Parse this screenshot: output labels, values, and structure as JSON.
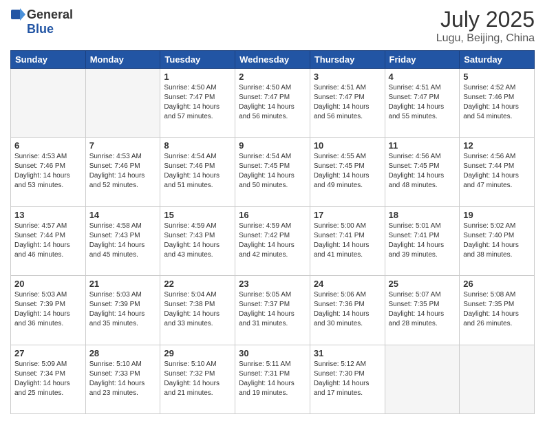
{
  "logo": {
    "general": "General",
    "blue": "Blue"
  },
  "title": {
    "month_year": "July 2025",
    "location": "Lugu, Beijing, China"
  },
  "weekdays": [
    "Sunday",
    "Monday",
    "Tuesday",
    "Wednesday",
    "Thursday",
    "Friday",
    "Saturday"
  ],
  "weeks": [
    [
      {
        "day": "",
        "empty": true
      },
      {
        "day": "",
        "empty": true
      },
      {
        "day": "1",
        "sunrise": "4:50 AM",
        "sunset": "7:47 PM",
        "daylight": "14 hours and 57 minutes."
      },
      {
        "day": "2",
        "sunrise": "4:50 AM",
        "sunset": "7:47 PM",
        "daylight": "14 hours and 56 minutes."
      },
      {
        "day": "3",
        "sunrise": "4:51 AM",
        "sunset": "7:47 PM",
        "daylight": "14 hours and 56 minutes."
      },
      {
        "day": "4",
        "sunrise": "4:51 AM",
        "sunset": "7:47 PM",
        "daylight": "14 hours and 55 minutes."
      },
      {
        "day": "5",
        "sunrise": "4:52 AM",
        "sunset": "7:46 PM",
        "daylight": "14 hours and 54 minutes."
      }
    ],
    [
      {
        "day": "6",
        "sunrise": "4:53 AM",
        "sunset": "7:46 PM",
        "daylight": "14 hours and 53 minutes."
      },
      {
        "day": "7",
        "sunrise": "4:53 AM",
        "sunset": "7:46 PM",
        "daylight": "14 hours and 52 minutes."
      },
      {
        "day": "8",
        "sunrise": "4:54 AM",
        "sunset": "7:46 PM",
        "daylight": "14 hours and 51 minutes."
      },
      {
        "day": "9",
        "sunrise": "4:54 AM",
        "sunset": "7:45 PM",
        "daylight": "14 hours and 50 minutes."
      },
      {
        "day": "10",
        "sunrise": "4:55 AM",
        "sunset": "7:45 PM",
        "daylight": "14 hours and 49 minutes."
      },
      {
        "day": "11",
        "sunrise": "4:56 AM",
        "sunset": "7:45 PM",
        "daylight": "14 hours and 48 minutes."
      },
      {
        "day": "12",
        "sunrise": "4:56 AM",
        "sunset": "7:44 PM",
        "daylight": "14 hours and 47 minutes."
      }
    ],
    [
      {
        "day": "13",
        "sunrise": "4:57 AM",
        "sunset": "7:44 PM",
        "daylight": "14 hours and 46 minutes."
      },
      {
        "day": "14",
        "sunrise": "4:58 AM",
        "sunset": "7:43 PM",
        "daylight": "14 hours and 45 minutes."
      },
      {
        "day": "15",
        "sunrise": "4:59 AM",
        "sunset": "7:43 PM",
        "daylight": "14 hours and 43 minutes."
      },
      {
        "day": "16",
        "sunrise": "4:59 AM",
        "sunset": "7:42 PM",
        "daylight": "14 hours and 42 minutes."
      },
      {
        "day": "17",
        "sunrise": "5:00 AM",
        "sunset": "7:41 PM",
        "daylight": "14 hours and 41 minutes."
      },
      {
        "day": "18",
        "sunrise": "5:01 AM",
        "sunset": "7:41 PM",
        "daylight": "14 hours and 39 minutes."
      },
      {
        "day": "19",
        "sunrise": "5:02 AM",
        "sunset": "7:40 PM",
        "daylight": "14 hours and 38 minutes."
      }
    ],
    [
      {
        "day": "20",
        "sunrise": "5:03 AM",
        "sunset": "7:39 PM",
        "daylight": "14 hours and 36 minutes."
      },
      {
        "day": "21",
        "sunrise": "5:03 AM",
        "sunset": "7:39 PM",
        "daylight": "14 hours and 35 minutes."
      },
      {
        "day": "22",
        "sunrise": "5:04 AM",
        "sunset": "7:38 PM",
        "daylight": "14 hours and 33 minutes."
      },
      {
        "day": "23",
        "sunrise": "5:05 AM",
        "sunset": "7:37 PM",
        "daylight": "14 hours and 31 minutes."
      },
      {
        "day": "24",
        "sunrise": "5:06 AM",
        "sunset": "7:36 PM",
        "daylight": "14 hours and 30 minutes."
      },
      {
        "day": "25",
        "sunrise": "5:07 AM",
        "sunset": "7:35 PM",
        "daylight": "14 hours and 28 minutes."
      },
      {
        "day": "26",
        "sunrise": "5:08 AM",
        "sunset": "7:35 PM",
        "daylight": "14 hours and 26 minutes."
      }
    ],
    [
      {
        "day": "27",
        "sunrise": "5:09 AM",
        "sunset": "7:34 PM",
        "daylight": "14 hours and 25 minutes."
      },
      {
        "day": "28",
        "sunrise": "5:10 AM",
        "sunset": "7:33 PM",
        "daylight": "14 hours and 23 minutes."
      },
      {
        "day": "29",
        "sunrise": "5:10 AM",
        "sunset": "7:32 PM",
        "daylight": "14 hours and 21 minutes."
      },
      {
        "day": "30",
        "sunrise": "5:11 AM",
        "sunset": "7:31 PM",
        "daylight": "14 hours and 19 minutes."
      },
      {
        "day": "31",
        "sunrise": "5:12 AM",
        "sunset": "7:30 PM",
        "daylight": "14 hours and 17 minutes."
      },
      {
        "day": "",
        "empty": true
      },
      {
        "day": "",
        "empty": true
      }
    ]
  ],
  "labels": {
    "sunrise": "Sunrise:",
    "sunset": "Sunset:",
    "daylight": "Daylight:"
  }
}
